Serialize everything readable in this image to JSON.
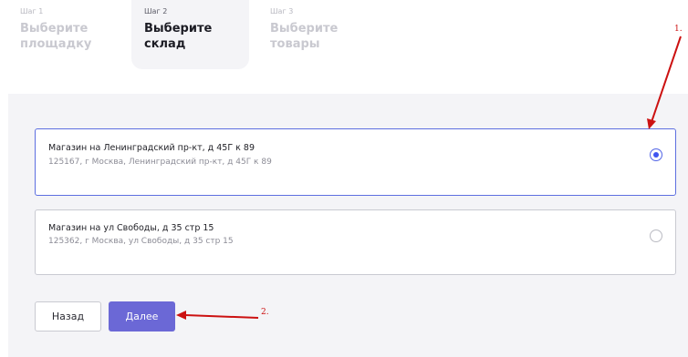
{
  "stepper": {
    "steps": [
      {
        "number": "Шаг 1",
        "title_line1": "Выберите",
        "title_line2": "площадку",
        "state": "inactive"
      },
      {
        "number": "Шаг 2",
        "title_line1": "Выберите",
        "title_line2": "склад",
        "state": "active"
      },
      {
        "number": "Шаг 3",
        "title_line1": "Выберите",
        "title_line2": "товары",
        "state": "inactive"
      }
    ]
  },
  "warehouses": [
    {
      "title": "Магазин на Ленинградский пр-кт, д 45Г к 89",
      "address": "125167, г Москва, Ленинградский пр-кт, д 45Г к 89",
      "selected": true
    },
    {
      "title": "Магазин на ул Свободы, д 35 стр 15",
      "address": "125362, г Москва, ул Свободы, д 35 стр 15",
      "selected": false
    }
  ],
  "actions": {
    "back_label": "Назад",
    "next_label": "Далее"
  },
  "annotations": {
    "label_1": "1.",
    "label_2": "2.",
    "color": "#cc1111"
  },
  "colors": {
    "accent": "#6b68d6",
    "selected_border": "#5d6fe0",
    "radio_dot": "#3f55f0",
    "panel_bg": "#f4f4f7"
  }
}
